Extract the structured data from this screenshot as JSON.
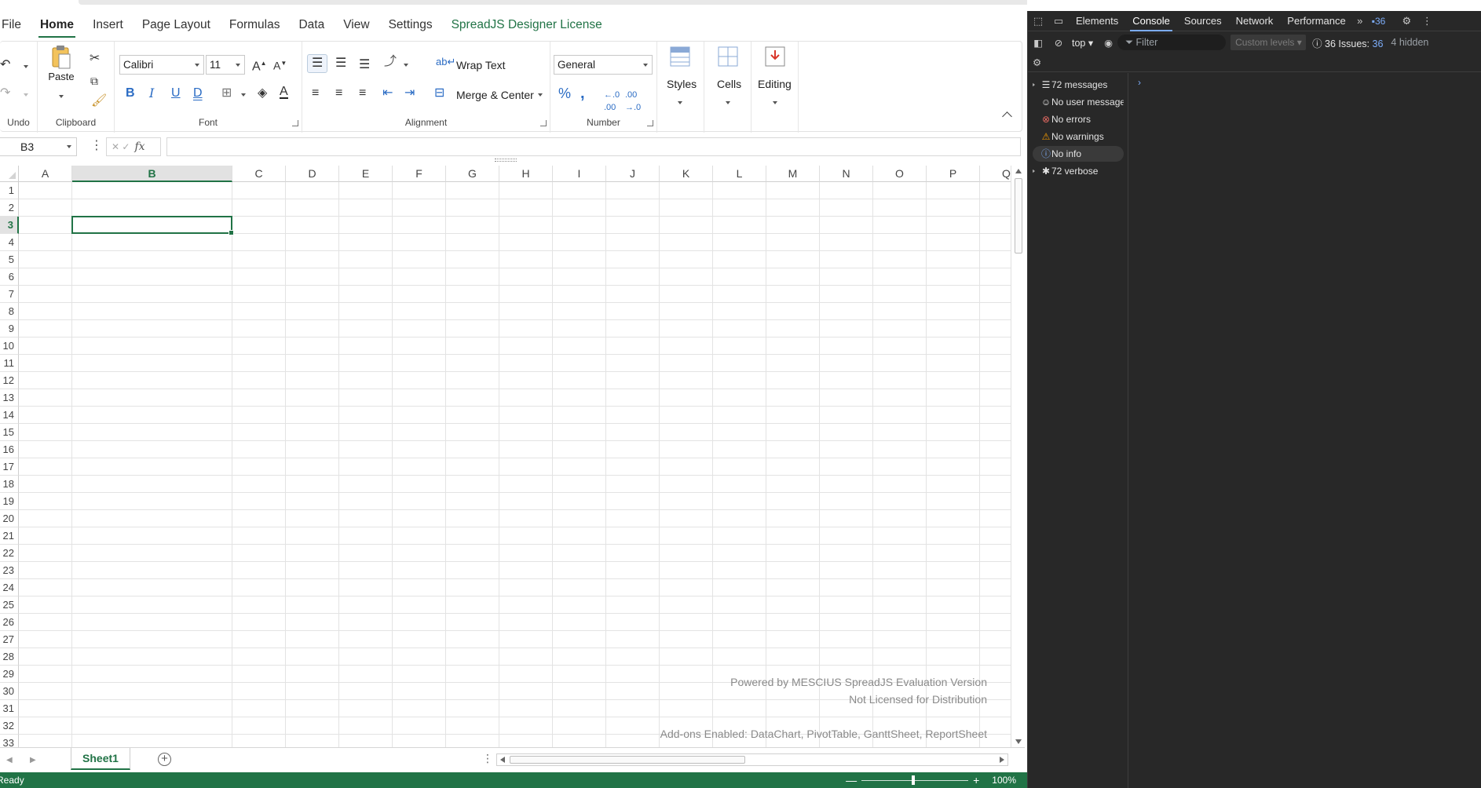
{
  "ribbon_tabs": [
    "File",
    "Home",
    "Insert",
    "Page Layout",
    "Formulas",
    "Data",
    "View",
    "Settings",
    "SpreadJS Designer License"
  ],
  "ribbon": {
    "undo_label": "Undo",
    "clipboard_label": "Clipboard",
    "paste_label": "Paste",
    "font_label": "Font",
    "font_name": "Calibri",
    "font_size": "11",
    "alignment_label": "Alignment",
    "wrap_text": "Wrap Text",
    "merge_center": "Merge & Center",
    "number_label": "Number",
    "number_format": "General",
    "styles_label": "Styles",
    "cells_label": "Cells",
    "editing_label": "Editing"
  },
  "formula_bar": {
    "name_box": "B3",
    "fx_glyph": "fx",
    "formula": ""
  },
  "grid": {
    "columns": [
      "A",
      "B",
      "C",
      "D",
      "E",
      "F",
      "G",
      "H",
      "I",
      "J",
      "K",
      "L",
      "M",
      "N",
      "O",
      "P",
      "Q"
    ],
    "selected_column": "B",
    "rows": [
      "1",
      "2",
      "3",
      "4",
      "5",
      "6",
      "7",
      "8",
      "9",
      "10",
      "11",
      "12",
      "13",
      "14",
      "15",
      "16",
      "17",
      "18",
      "19",
      "20",
      "21",
      "22",
      "23",
      "24",
      "25",
      "26",
      "27",
      "28",
      "29",
      "30",
      "31",
      "32",
      "33"
    ],
    "selected_row": "3",
    "watermark": {
      "line1": "Powered by MESCIUS SpreadJS Evaluation Version",
      "line2": "Not Licensed for Distribution",
      "line3": "Add-ons Enabled: DataChart, PivotTable, GanttSheet, ReportSheet"
    }
  },
  "sheet_tabs": [
    "Sheet1"
  ],
  "status": {
    "text": "Ready",
    "zoom": "100%",
    "zoom_level_percent": 100
  },
  "devtools": {
    "tabs": [
      "Elements",
      "Console",
      "Sources",
      "Network",
      "Performance"
    ],
    "active_tab": "Console",
    "issues_badge": "36",
    "context": "top",
    "filter_placeholder": "Filter",
    "levels": "Custom levels",
    "issues_text": "36 Issues:",
    "issues_count": "36",
    "hidden_text": "4 hidden",
    "sidebar": [
      {
        "icon": "list-icon",
        "label": "72 messages",
        "expandable": true
      },
      {
        "icon": "user-icon",
        "label": "No user messages",
        "expandable": false
      },
      {
        "icon": "error-icon",
        "label": "No errors",
        "expandable": false
      },
      {
        "icon": "warning-icon",
        "label": "No warnings",
        "expandable": false
      },
      {
        "icon": "info-icon",
        "label": "No info",
        "expandable": false,
        "selected": true
      },
      {
        "icon": "bug-icon",
        "label": "72 verbose",
        "expandable": true
      }
    ],
    "colors": {
      "background": "#282828",
      "accent": "#7cacf8",
      "error": "#e46962",
      "warning": "#f29900"
    }
  },
  "colors": {
    "accent": "#217346"
  }
}
